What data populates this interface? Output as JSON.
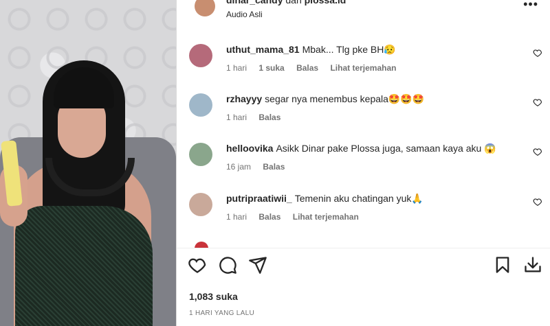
{
  "post": {
    "header_user": "dinar_candy",
    "header_and": "dan",
    "header_collab": "plossa.id",
    "audio": "Audio Asli",
    "more": "•••"
  },
  "comments": [
    {
      "user": "uthut_mama_81",
      "text": "Mbak... Tlg pke BH😥",
      "time": "1 hari",
      "likes": "1 suka",
      "reply": "Balas",
      "translate": "Lihat terjemahan",
      "avatar_color": "#b56a7a"
    },
    {
      "user": "rzhayyy",
      "text": "segar nya menembus kepala🤩🤩🤩",
      "time": "1 hari",
      "likes": "",
      "reply": "Balas",
      "translate": "",
      "avatar_color": "#9fb7c9"
    },
    {
      "user": "helloovika",
      "text": "Asikk Dinar pake Plossa juga, samaan kaya aku 😱",
      "time": "16 jam",
      "likes": "",
      "reply": "Balas",
      "translate": "",
      "avatar_color": "#8aa68c"
    },
    {
      "user": "putripraatiwii_",
      "text": "Temenin aku chatingan yuk🙏",
      "time": "1 hari",
      "likes": "",
      "reply": "Balas",
      "translate": "Lihat terjemahan",
      "avatar_color": "#c9a99a"
    }
  ],
  "footer": {
    "likes": "1,083 suka",
    "time_ago": "1 HARI YANG LALU"
  },
  "icons": [
    "heart-icon",
    "comment-icon",
    "share-icon",
    "bookmark-icon",
    "download-icon",
    "more-icon"
  ]
}
